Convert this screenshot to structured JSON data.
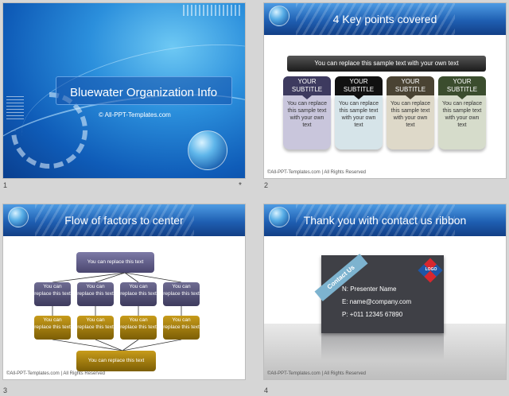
{
  "slides": [
    {
      "num": "1",
      "star": "*",
      "title": "Bluewater Organization Info",
      "subtitle": "© All-PPT-Templates.com"
    },
    {
      "num": "2",
      "title": "4 Key points covered",
      "bar_text": "You can replace this sample text with your own text",
      "cards": [
        {
          "head": "YOUR SUBTITLE",
          "body": "You can replace this sample text with your own text",
          "head_color": "#3d3a5f",
          "body_color": "#c9c6dc"
        },
        {
          "head": "YOUR SUBTITLE",
          "body": "You can replace this sample text with your own text",
          "head_color": "#111111",
          "body_color": "#d6e4e9"
        },
        {
          "head": "YOUR SUBTITLE",
          "body": "You can replace this sample text with your own text",
          "head_color": "#4a4333",
          "body_color": "#ded9c9"
        },
        {
          "head": "YOUR SUBTITLE",
          "body": "You can replace this sample text with your own text",
          "head_color": "#3b4d2e",
          "body_color": "#d6dccb"
        }
      ],
      "footer": "©All-PPT-Templates.com | All Rights Reserved"
    },
    {
      "num": "3",
      "title": "Flow of factors to center",
      "top_box": "You can replace this text",
      "mid_boxes": [
        "You can replace this text",
        "You can replace this text",
        "You can replace this text",
        "You can replace this text"
      ],
      "gold_boxes": [
        "You can replace this text",
        "You can replace this text",
        "You can replace this text",
        "You can replace this text"
      ],
      "bottom_box": "You can replace this text",
      "footer": "©All-PPT-Templates.com | All Rights Reserved"
    },
    {
      "num": "4",
      "title": "Thank you with contact us ribbon",
      "ribbon": "Contact Us",
      "logo": "LOGO",
      "name_line": "N: Presenter Name",
      "email_line": "E: name@company.com",
      "phone_line": "P: +011 12345 67890",
      "footer": "©All-PPT-Templates.com | All Rights Reserved"
    }
  ]
}
